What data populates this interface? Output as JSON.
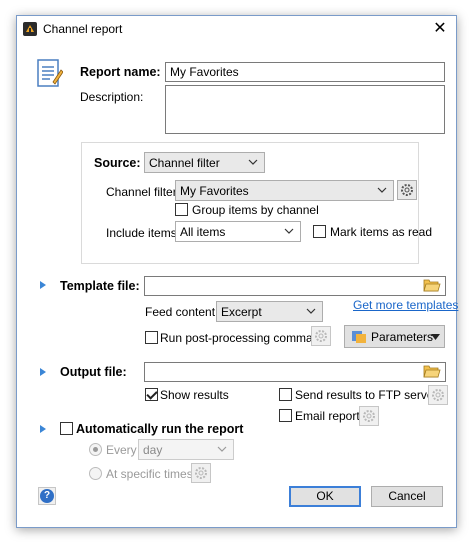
{
  "window": {
    "title": "Channel report",
    "close_glyph": "✕"
  },
  "report": {
    "name_label": "Report name:",
    "name_value": "My Favorites",
    "description_label": "Description:",
    "description_value": ""
  },
  "source": {
    "label": "Source:",
    "value": "Channel filter",
    "channel_filter_label": "Channel filter:",
    "channel_filter_value": "My Favorites",
    "group_items_label": "Group items by channel",
    "group_items_checked": false,
    "include_items_label": "Include items:",
    "include_items_value": "All items",
    "mark_read_label": "Mark items as read",
    "mark_read_checked": false
  },
  "template": {
    "label": "Template file:",
    "value": "",
    "feed_content_label": "Feed content:",
    "feed_content_value": "Excerpt",
    "more_templates_link": "Get more templates",
    "post_processing_label": "Run post-processing command",
    "post_processing_checked": false,
    "parameters_label": "Parameters"
  },
  "output": {
    "label": "Output file:",
    "value": "",
    "show_results_label": "Show results",
    "show_results_checked": true,
    "ftp_label": "Send results to FTP server",
    "ftp_checked": false,
    "email_label": "Email report",
    "email_checked": false
  },
  "auto_run": {
    "label": "Automatically run the report",
    "checked": false,
    "every_label": "Every",
    "every_value": "day",
    "specific_times_label": "At specific times"
  },
  "buttons": {
    "ok": "OK",
    "cancel": "Cancel",
    "help_glyph": "?"
  },
  "colors": {
    "accent": "#3b86d6",
    "link": "#1a66c9",
    "ok_border": "#3c7fd8",
    "folder": "#e8b83a"
  }
}
